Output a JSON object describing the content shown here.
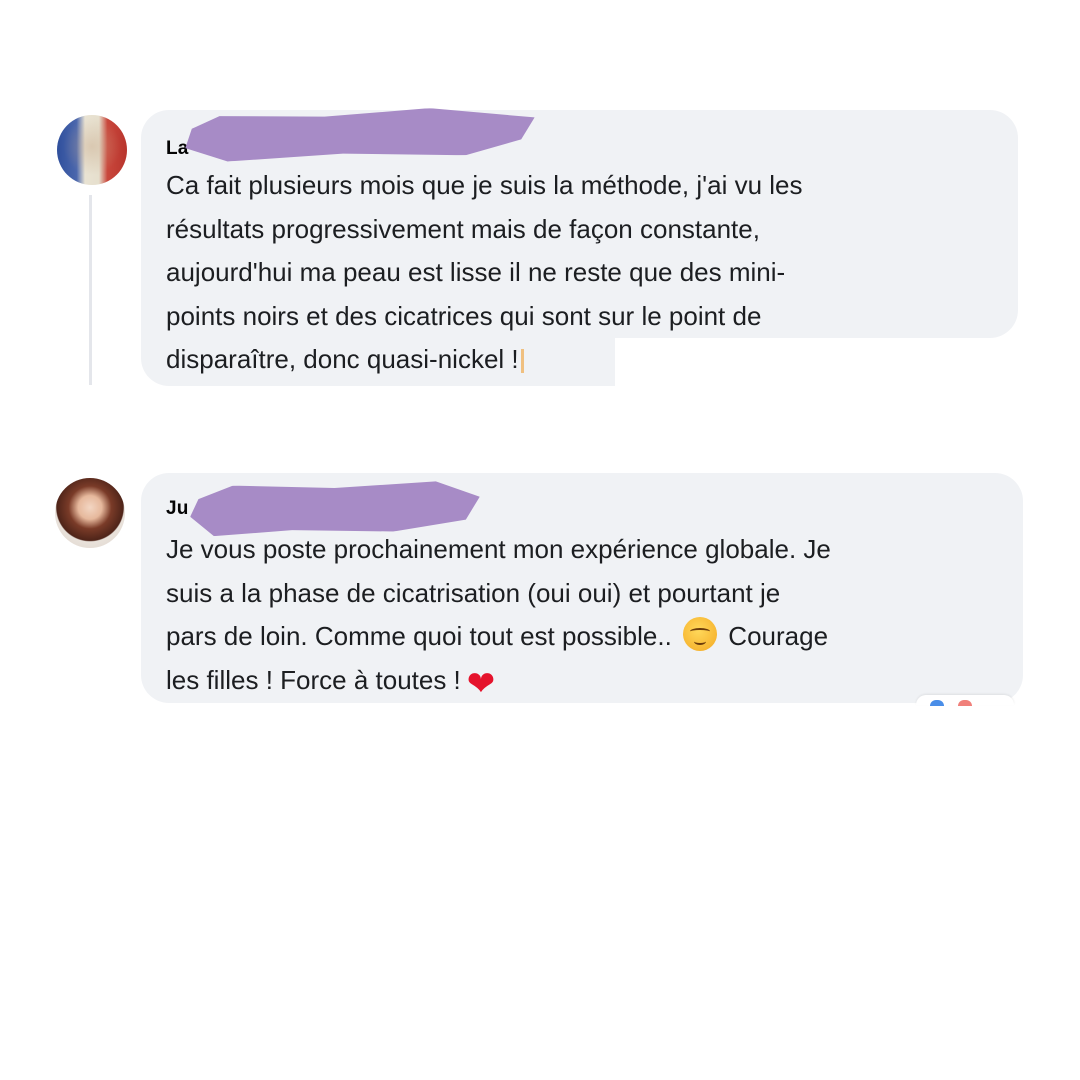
{
  "comments": [
    {
      "author": "La",
      "author_redacted": true,
      "avatar": "flag-avatar",
      "lines": [
        "Ca fait plusieurs mois que je suis la méthode, j'ai vu les",
        "résultats progressivement mais de façon constante,",
        "aujourd'hui ma peau est lisse il ne reste que des mini-",
        "points noirs et des cicatrices qui sont sur le point de",
        "disparaître, donc quasi-nickel !"
      ]
    },
    {
      "author": "Ju",
      "author_redacted": true,
      "avatar": "woman-avatar",
      "lines": [
        "Je vous poste prochainement mon expérience globale. Je",
        "suis a la phase de cicatrisation (oui oui) et pourtant je",
        "pars de loin. Comme quoi tout est possible..",
        "Courage",
        "les filles ! Force à toutes !"
      ],
      "emojis": [
        "relieved-face-emoji",
        "red-heart-emoji"
      ],
      "heart_char": "❤",
      "reactions": [
        "like-reaction-icon",
        "love-reaction-icon"
      ]
    }
  ],
  "colors": {
    "bubble": "#f0f2f5",
    "redaction": "#a78bc6",
    "text": "#1c1e21",
    "thread_line": "#e4e6eb"
  }
}
